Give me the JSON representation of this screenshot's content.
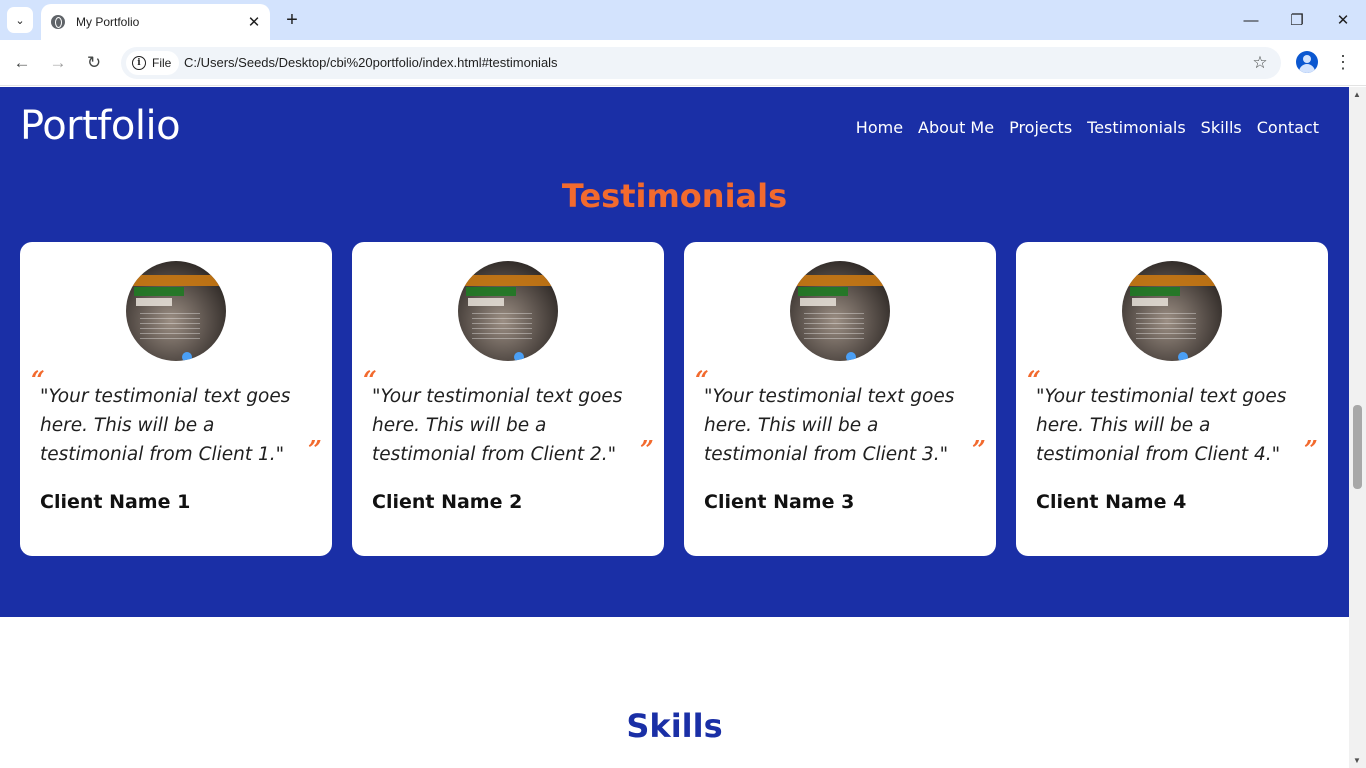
{
  "browser": {
    "tab_title": "My Portfolio",
    "site_chip_label": "File",
    "url": "C:/Users/Seeds/Desktop/cbi%20portfolio/index.html#testimonials",
    "icons": {
      "tab_search": "chevron-down-icon",
      "favicon": "globe-icon",
      "tab_close": "close-icon",
      "new_tab": "plus-icon",
      "minimize": "minimize-icon",
      "restore": "restore-icon",
      "close_window": "close-icon",
      "back": "back-arrow-icon",
      "forward": "forward-arrow-icon",
      "reload": "reload-icon",
      "site_info": "info-icon",
      "bookmark": "star-icon",
      "profile": "profile-icon",
      "menu": "kebab-menu-icon"
    },
    "glyphs": {
      "tab_search": "⌄",
      "tab_close": "✕",
      "new_tab": "+",
      "minimize": "—",
      "restore": "❐",
      "close_window": "✕",
      "back": "←",
      "forward": "→",
      "reload": "↻",
      "info": "i",
      "star": "☆",
      "menu": "⋮",
      "scroll_up": "▲",
      "scroll_down": "▼"
    }
  },
  "site": {
    "logo": "Portfolio",
    "nav": [
      "Home",
      "About Me",
      "Projects",
      "Testimonials",
      "Skills",
      "Contact"
    ]
  },
  "testimonials": {
    "title": "Testimonials",
    "quote_open": "“",
    "quote_close": "”",
    "cards": [
      {
        "text": "\"Your testimonial text goes here. This will be a testimonial from Client 1.\"",
        "name": "Client Name 1"
      },
      {
        "text": "\"Your testimonial text goes here. This will be a testimonial from Client 2.\"",
        "name": "Client Name 2"
      },
      {
        "text": "\"Your testimonial text goes here. This will be a testimonial from Client 3.\"",
        "name": "Client Name 3"
      },
      {
        "text": "\"Your testimonial text goes here. This will be a testimonial from Client 4.\"",
        "name": "Client Name 4"
      }
    ]
  },
  "skills": {
    "title": "Skills"
  },
  "colors": {
    "section_bg": "#1a2fa6",
    "accent_orange": "#f26a2e",
    "tabstrip_bg": "#d3e3fd",
    "card_bg": "#ffffff"
  }
}
